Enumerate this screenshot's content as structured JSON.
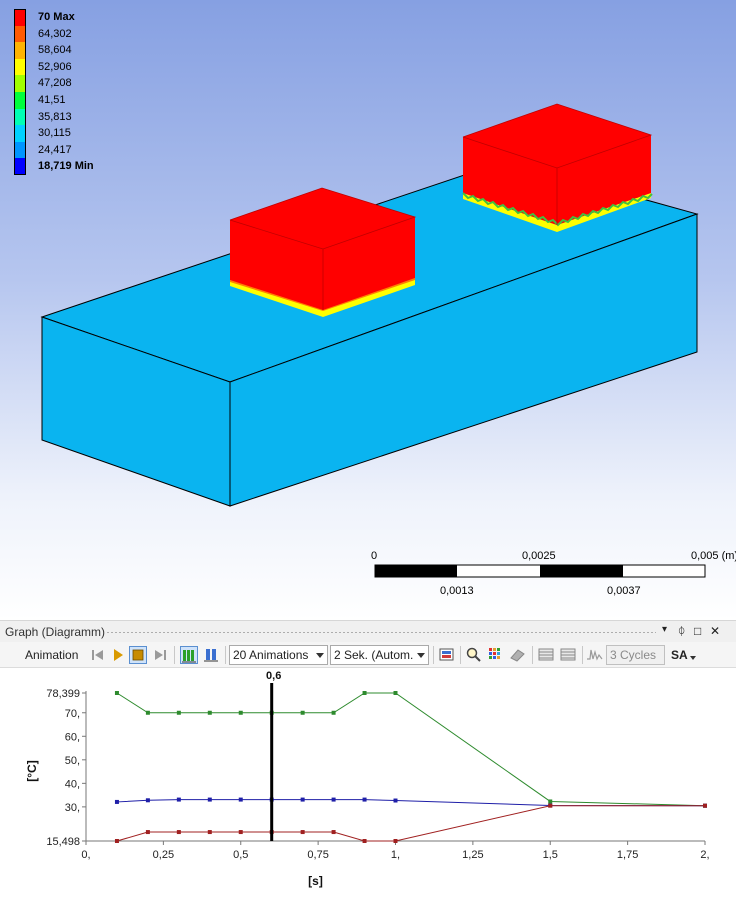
{
  "legend": {
    "entries": [
      {
        "label": "70 Max",
        "color": "#ff0000",
        "bold": true
      },
      {
        "label": "64,302",
        "color": "#ff5a00",
        "bold": false
      },
      {
        "label": "58,604",
        "color": "#ffb400",
        "bold": false
      },
      {
        "label": "52,906",
        "color": "#ffff00",
        "bold": false
      },
      {
        "label": "47,208",
        "color": "#a0ff00",
        "bold": false
      },
      {
        "label": "41,51",
        "color": "#00ff3c",
        "bold": false
      },
      {
        "label": "35,813",
        "color": "#00ffb4",
        "bold": false
      },
      {
        "label": "30,115",
        "color": "#00d2ff",
        "bold": false
      },
      {
        "label": "24,417",
        "color": "#0096ff",
        "bold": false
      },
      {
        "label": "18,719 Min",
        "color": "#0000ff",
        "bold": true
      }
    ]
  },
  "scale_bar": {
    "top_labels": [
      "0",
      "0,0025",
      "0,005 (m)"
    ],
    "bottom_labels": [
      "0,0013",
      "0,0037"
    ]
  },
  "graph_panel": {
    "title": "Graph (Diagramm)",
    "window_buttons": [
      "▾",
      "ᛰ",
      "□",
      "✕"
    ],
    "toolbar": {
      "animation_label": "Animation",
      "frames_select": "20 Animations",
      "duration_select": "2 Sek. (Autom.",
      "cycles_select": "3 Cycles",
      "sa_label": "SA"
    }
  },
  "chart_data": {
    "type": "line",
    "xlabel": "[s]",
    "ylabel": "[°C]",
    "xlim": [
      0,
      2
    ],
    "ylim": [
      15.498,
      78.399
    ],
    "x_ticks": [
      "0,",
      "0,25",
      "0,5",
      "0,75",
      "1,",
      "1,25",
      "1,5",
      "1,75",
      "2,"
    ],
    "y_ticks": [
      "15,498",
      "30,",
      "40,",
      "50,",
      "60,",
      "70,",
      "78,399"
    ],
    "cursor_value": 0.6,
    "cursor_label": "0,6",
    "series": [
      {
        "color": "#2e8b2e",
        "x": [
          0.1,
          0.2,
          0.3,
          0.4,
          0.5,
          0.6,
          0.7,
          0.8,
          0.9,
          1.0,
          1.5,
          2.0
        ],
        "y": [
          78.399,
          70,
          70,
          70,
          70,
          70,
          70,
          70,
          78.399,
          78.399,
          32.3,
          30.5
        ]
      },
      {
        "color": "#1f1fa8",
        "x": [
          0.1,
          0.2,
          0.3,
          0.4,
          0.5,
          0.6,
          0.7,
          0.8,
          0.9,
          1.0,
          1.5,
          2.0
        ],
        "y": [
          32.1,
          32.8,
          33.1,
          33.1,
          33.1,
          33.1,
          33.1,
          33.1,
          33.1,
          32.7,
          30.6,
          30.5
        ]
      },
      {
        "color": "#a02020",
        "x": [
          0.1,
          0.2,
          0.3,
          0.4,
          0.5,
          0.6,
          0.7,
          0.8,
          0.9,
          1.0,
          1.5,
          2.0
        ],
        "y": [
          15.498,
          19.3,
          19.3,
          19.3,
          19.3,
          19.3,
          19.3,
          19.3,
          15.498,
          15.498,
          30.5,
          30.5
        ]
      }
    ]
  }
}
